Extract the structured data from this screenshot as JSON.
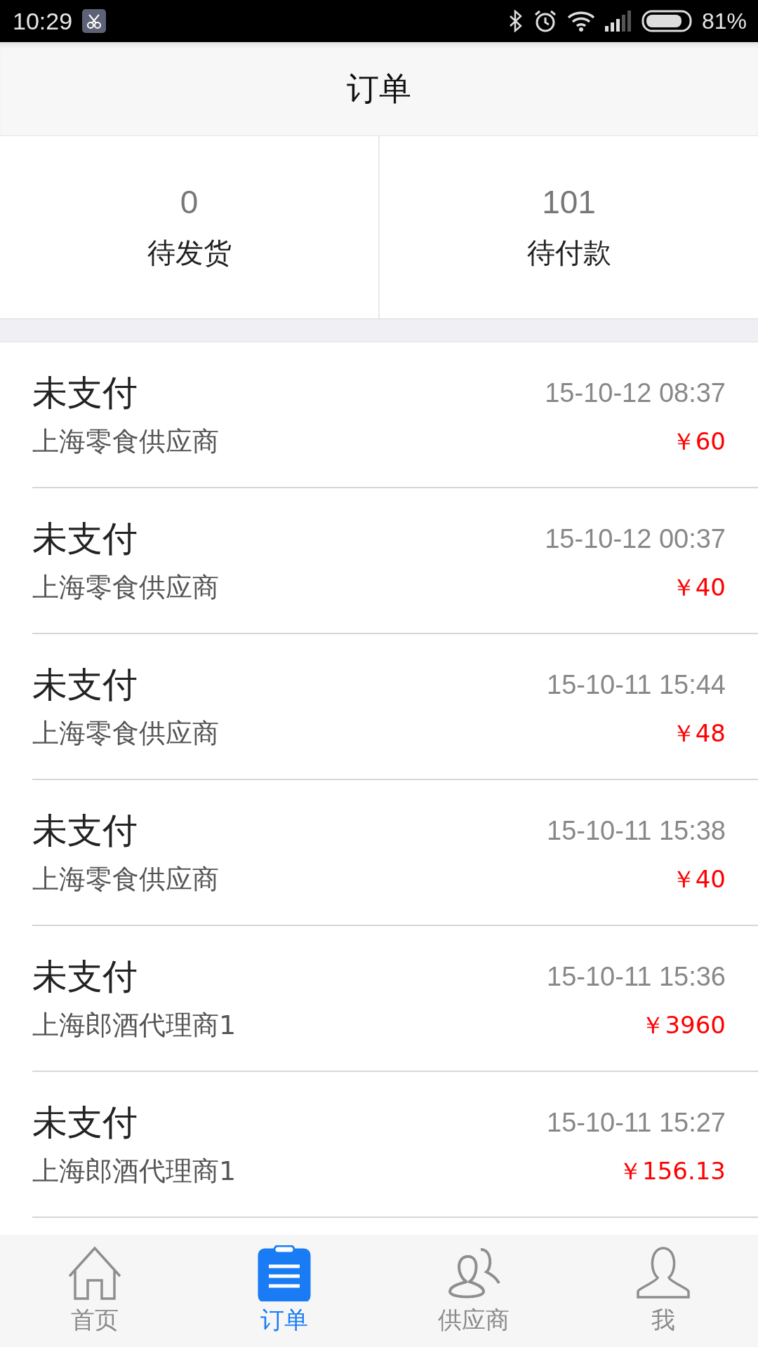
{
  "status_bar": {
    "time": "10:29",
    "battery": "81%"
  },
  "header": {
    "title": "订单"
  },
  "stats": [
    {
      "count": "0",
      "label": "待发货"
    },
    {
      "count": "101",
      "label": "待付款"
    }
  ],
  "orders": [
    {
      "status": "未支付",
      "supplier": "上海零食供应商",
      "time": "15-10-12 08:37",
      "amount": "￥60"
    },
    {
      "status": "未支付",
      "supplier": "上海零食供应商",
      "time": "15-10-12 00:37",
      "amount": "￥40"
    },
    {
      "status": "未支付",
      "supplier": "上海零食供应商",
      "time": "15-10-11 15:44",
      "amount": "￥48"
    },
    {
      "status": "未支付",
      "supplier": "上海零食供应商",
      "time": "15-10-11 15:38",
      "amount": "￥40"
    },
    {
      "status": "未支付",
      "supplier": "上海郎酒代理商1",
      "time": "15-10-11 15:36",
      "amount": "￥3960"
    },
    {
      "status": "未支付",
      "supplier": "上海郎酒代理商1",
      "time": "15-10-11 15:27",
      "amount": "￥156.13"
    }
  ],
  "tab_bar": [
    {
      "kind": "home",
      "label": "首页",
      "selected": false
    },
    {
      "kind": "orders",
      "label": "订单",
      "selected": true
    },
    {
      "kind": "suppliers",
      "label": "供应商",
      "selected": false
    },
    {
      "kind": "me",
      "label": "我",
      "selected": false
    }
  ]
}
